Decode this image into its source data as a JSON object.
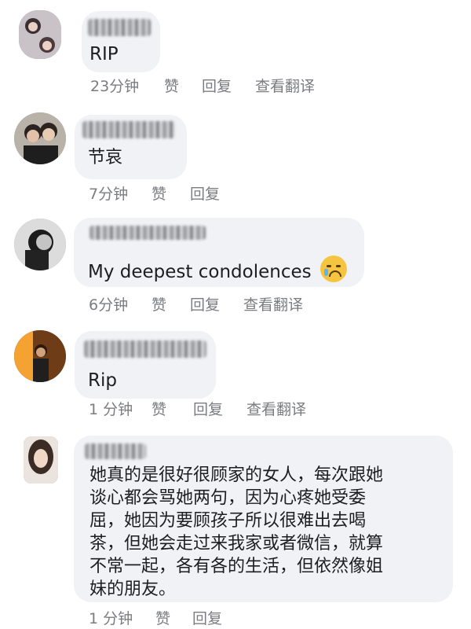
{
  "comments": [
    {
      "text": "RIP",
      "time": "23分钟",
      "like": "赞",
      "reply": "回复",
      "translate": "查看翻译"
    },
    {
      "text": "节哀",
      "time": "7分钟",
      "like": "赞",
      "reply": "回复"
    },
    {
      "text": "My deepest condolences",
      "emoji": "crying-face-emoji",
      "time": "6分钟",
      "like": "赞",
      "reply": "回复",
      "translate": "查看翻译"
    },
    {
      "text": "Rip",
      "time": "1 分钟",
      "like": "赞",
      "reply": "回复",
      "translate": "查看翻译"
    },
    {
      "text_lines": [
        "她真的是很好很顾家的女人，每次跟她",
        "谈心都会骂她两句，因为心疼她受委",
        "屈，她因为要顾孩子所以很难出去喝",
        "茶，但她会走过来我家或者微信，就算",
        "不常一起，各有各的生活，但依然像姐",
        "妹的朋友。"
      ],
      "time": "1 分钟",
      "like": "赞",
      "reply": "回复"
    }
  ]
}
